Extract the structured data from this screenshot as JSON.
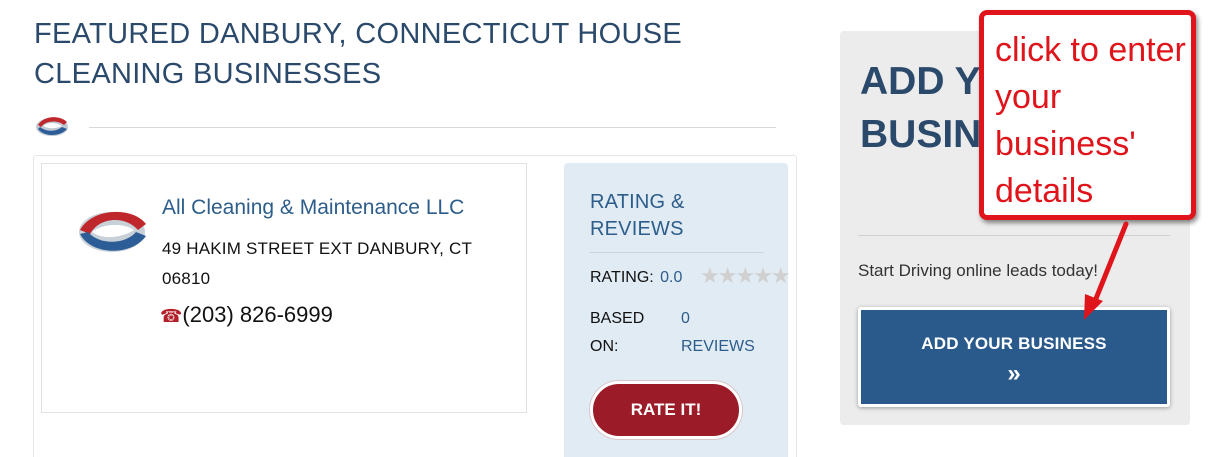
{
  "section": {
    "title": "FEATURED DANBURY, CONNECTICUT HOUSE CLEANING BUSINESSES"
  },
  "listing": {
    "name": "All Cleaning & Maintenance LLC",
    "address": "49 HAKIM STREET EXT  DANBURY, CT  06810",
    "phone_icon": "☎",
    "phone": "(203) 826-6999"
  },
  "rating": {
    "title": "RATING & REVIEWS",
    "rating_label": "RATING:",
    "rating_value": "0.0",
    "stars_filled": 0,
    "stars_total": 5,
    "stars_glyphs": "★★★★★",
    "based_label": "BASED ON:",
    "reviews_count": "0",
    "reviews_label": "REVIEWS",
    "rate_button": "RATE IT!"
  },
  "add_business": {
    "heading": "ADD YOUR BUSINESS",
    "subtitle": "Start Driving online leads today!",
    "button_label": "ADD YOUR BUSINESS",
    "button_chevron": "»"
  },
  "callout": {
    "text": "click to enter your business' details"
  },
  "colors": {
    "heading_blue": "#2b4a6b",
    "link_blue": "#2d5d8a",
    "rate_button_red": "#9b1c28",
    "callout_red": "#e0141b",
    "add_button_blue": "#2a5a8c",
    "rating_panel_bg": "#e0ebf4"
  }
}
